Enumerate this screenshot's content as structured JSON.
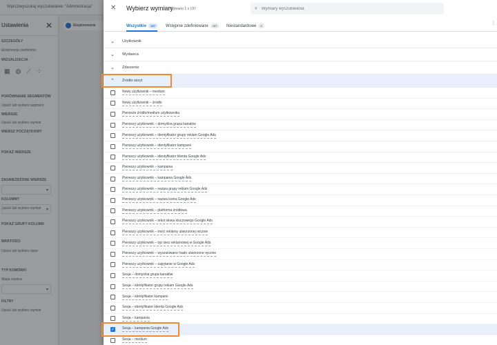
{
  "background": {
    "topbar_text": "Wpisz/wyszukaj wyszukiwanie: “Administracja”",
    "panel_title": "Ustawienia",
    "tab_label": "Eksplorowanie",
    "labels": [
      {
        "text": "SZCZEGÓŁY",
        "cap": true
      },
      {
        "text": "Eksploracja swobodna",
        "cap": false
      },
      {
        "text": "WIZUALIZACJA",
        "cap": true
      },
      {
        "text": "PORÓWNANIE SEGMENTÓW",
        "cap": true
      },
      {
        "text": "Upuść lub wybierz segment",
        "cap": false
      },
      {
        "text": "WIERSZE",
        "cap": true
      },
      {
        "text": "Upuść lub wybierz wymiar",
        "cap": false
      },
      {
        "text": "WIERSZ POCZĄTKOWY",
        "cap": true
      },
      {
        "text": "POKAŻ WIERSZE",
        "cap": true
      },
      {
        "text": "ZAGNIEŻDŻONE WIERSZE",
        "cap": true
      },
      {
        "text": "KOLUMNY",
        "cap": true
      },
      {
        "text": "Upuść lub wybierz wymiar",
        "cap": false
      },
      {
        "text": "POKAŻ GRUPY KOLUMN",
        "cap": true
      },
      {
        "text": "WARTOŚCI",
        "cap": true
      },
      {
        "text": "Upuść lub wybierz dane",
        "cap": false
      },
      {
        "text": "TYP KOMÓRKI",
        "cap": true
      },
      {
        "text": "Mapa cieplna",
        "cap": false
      },
      {
        "text": "FILTRY",
        "cap": true
      },
      {
        "text": "Upuść lub wybierz wymiar",
        "cap": false
      }
    ]
  },
  "dialog": {
    "close_icon": "close-icon",
    "title": "Wybierz wymiary",
    "subtitle": "Wybrano 1 z 197",
    "search_placeholder": "Wymiary wyszukiwania",
    "tabs": [
      {
        "label": "Wszystkie",
        "count": "197",
        "active": true
      },
      {
        "label": "Wstępnie zdefiniowane",
        "count": "197",
        "active": false
      },
      {
        "label": "Niestandardowe",
        "count": "0",
        "active": false
      }
    ],
    "collapsed_groups": [
      {
        "label": "Użytkownik"
      },
      {
        "label": "Wydawca"
      },
      {
        "label": "Zdarzenie"
      }
    ],
    "expanded_group": {
      "label": "Źródło wizyt"
    },
    "items": [
      {
        "label": "Nowy użytkownik – medium",
        "checked": false
      },
      {
        "label": "Nowy użytkownik – źródło",
        "checked": false
      },
      {
        "label": "Pierwsze źródło/medium użytkownika",
        "checked": false
      },
      {
        "label": "Pierwszy użytkownik – domyślna grupa kanałów",
        "checked": false
      },
      {
        "label": "Pierwszy użytkownik – identyfikator grupy reklam Google Ads",
        "checked": false
      },
      {
        "label": "Pierwszy użytkownik – identyfikator kampanii",
        "checked": false
      },
      {
        "label": "Pierwszy użytkownik – identyfikator klienta Google Ads",
        "checked": false
      },
      {
        "label": "Pierwszy użytkownik – kampania",
        "checked": false
      },
      {
        "label": "Pierwszy użytkownik – kampania Google Ads",
        "checked": false
      },
      {
        "label": "Pierwszy użytkownik – nazwa grupy reklam Google Ads",
        "checked": false
      },
      {
        "label": "Pierwszy użytkownik – nazwa konta Google Ads",
        "checked": false
      },
      {
        "label": "Pierwszy użytkownik – platforma źródłowa",
        "checked": false
      },
      {
        "label": "Pierwszy użytkownik – tekst słowa kluczowego Google Ads",
        "checked": false
      },
      {
        "label": "Pierwszy użytkownik – treść reklamy utworzonej ręcznie",
        "checked": false
      },
      {
        "label": "Pierwszy użytkownik – typ sieci reklamowej w Google Ads",
        "checked": false
      },
      {
        "label": "Pierwszy użytkownik – wyszukiwane hasło utworzone ręcznie",
        "checked": false
      },
      {
        "label": "Pierwszy użytkownik – zapytanie w Google Ads",
        "checked": false
      },
      {
        "label": "Sesja – domyślna grupa kanałów",
        "checked": false
      },
      {
        "label": "Sesja – identyfikator grupy reklam Google Ads",
        "checked": false
      },
      {
        "label": "Sesja – identyfikator kampanii",
        "checked": false
      },
      {
        "label": "Sesja – identyfikator klienta Google Ads",
        "checked": false
      },
      {
        "label": "Sesja – kampania",
        "checked": false
      },
      {
        "label": "Sesja – kampania Google Ads",
        "checked": true
      },
      {
        "label": "Sesja – medium",
        "checked": false
      }
    ]
  },
  "colors": {
    "accent": "#1a73e8",
    "highlight": "#f28b30",
    "selected_row": "#e8f0fe"
  }
}
